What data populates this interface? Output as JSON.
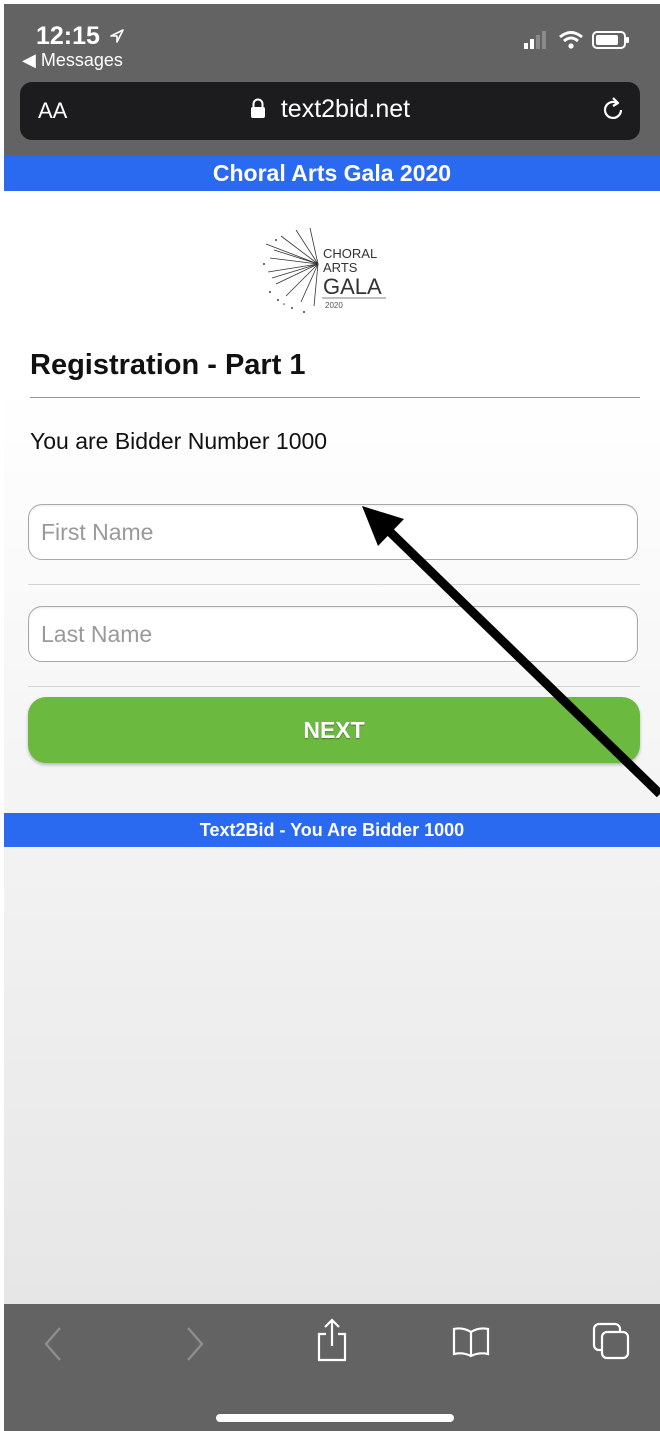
{
  "status_bar": {
    "time": "12:15",
    "back_app": "◀ Messages"
  },
  "address_bar": {
    "text_size_label": "AA",
    "url": "text2bid.net"
  },
  "page": {
    "header_title": "Choral Arts Gala 2020",
    "logo": {
      "line1": "CHORAL",
      "line2": "ARTS",
      "line3": "GALA",
      "year": "2020"
    },
    "heading": "Registration - Part 1",
    "bidder_text": "You are Bidder Number 1000",
    "first_name_placeholder": "First Name",
    "last_name_placeholder": "Last Name",
    "next_label": "NEXT",
    "footer_text": "Text2Bid - You Are Bidder 1000"
  },
  "colors": {
    "blue_bar": "#2a6af0",
    "next_button": "#6cb940",
    "chrome_gray": "#636363",
    "address_bar_bg": "#1c1c1e"
  },
  "icons": [
    "location-arrow-icon",
    "signal-icon",
    "wifi-icon",
    "battery-icon",
    "lock-icon",
    "reload-icon",
    "back-icon",
    "forward-icon",
    "share-icon",
    "bookmarks-icon",
    "tabs-icon"
  ]
}
